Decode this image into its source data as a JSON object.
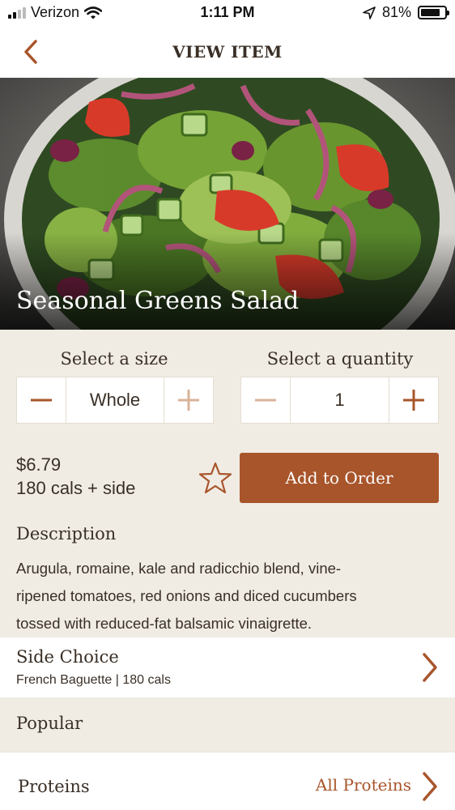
{
  "status_bar": {
    "carrier": "Verizon",
    "time": "1:11 PM",
    "battery_percent": "81%",
    "battery_level": 0.81
  },
  "nav": {
    "title": "VIEW ITEM",
    "back_icon": "chevron-left-icon"
  },
  "hero": {
    "title": "Seasonal Greens Salad"
  },
  "size_selector": {
    "label": "Select a size",
    "value": "Whole",
    "minus_icon": "minus-icon",
    "plus_icon": "plus-icon"
  },
  "quantity_selector": {
    "label": "Select a quantity",
    "value": "1",
    "minus_icon": "minus-icon",
    "plus_icon": "plus-icon"
  },
  "price_info": {
    "price": "$6.79",
    "calories": "180 cals + side"
  },
  "favorite_icon": "star-outline-icon",
  "add_button": {
    "label": "Add to Order"
  },
  "description": {
    "heading": "Description",
    "line1": "Arugula, romaine, kale and radicchio blend, vine-",
    "line2": "ripened tomatoes, red onions and diced cucumbers",
    "line3": "tossed with reduced-fat balsamic vinaigrette."
  },
  "side_choice": {
    "title": "Side Choice",
    "subtitle": "French Baguette | 180 cals"
  },
  "popular": {
    "heading": "Popular"
  },
  "proteins": {
    "heading": "Proteins",
    "link": "All Proteins"
  },
  "colors": {
    "accent": "#a8552b",
    "background_beige": "#f0ece4",
    "text_dark": "#3a2f26"
  }
}
